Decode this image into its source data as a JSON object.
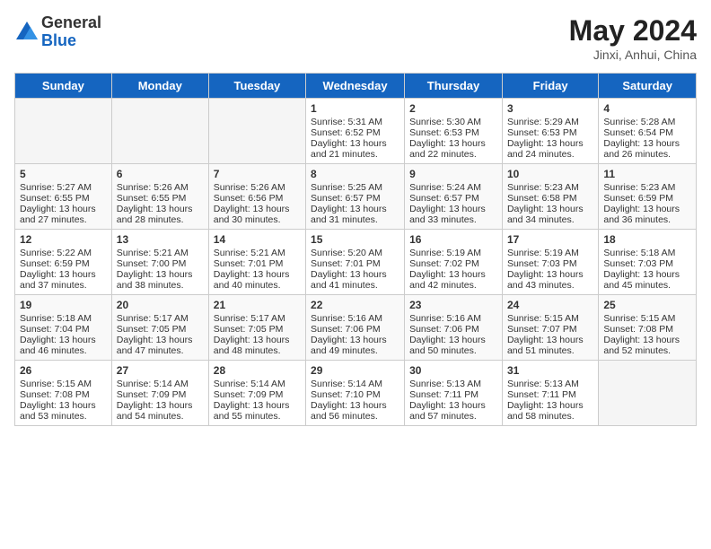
{
  "logo": {
    "general": "General",
    "blue": "Blue"
  },
  "title": {
    "month_year": "May 2024",
    "location": "Jinxi, Anhui, China"
  },
  "header_days": [
    "Sunday",
    "Monday",
    "Tuesday",
    "Wednesday",
    "Thursday",
    "Friday",
    "Saturday"
  ],
  "weeks": [
    [
      {
        "day": "",
        "sunrise": "",
        "sunset": "",
        "daylight": ""
      },
      {
        "day": "",
        "sunrise": "",
        "sunset": "",
        "daylight": ""
      },
      {
        "day": "",
        "sunrise": "",
        "sunset": "",
        "daylight": ""
      },
      {
        "day": "1",
        "sunrise": "Sunrise: 5:31 AM",
        "sunset": "Sunset: 6:52 PM",
        "daylight": "Daylight: 13 hours and 21 minutes."
      },
      {
        "day": "2",
        "sunrise": "Sunrise: 5:30 AM",
        "sunset": "Sunset: 6:53 PM",
        "daylight": "Daylight: 13 hours and 22 minutes."
      },
      {
        "day": "3",
        "sunrise": "Sunrise: 5:29 AM",
        "sunset": "Sunset: 6:53 PM",
        "daylight": "Daylight: 13 hours and 24 minutes."
      },
      {
        "day": "4",
        "sunrise": "Sunrise: 5:28 AM",
        "sunset": "Sunset: 6:54 PM",
        "daylight": "Daylight: 13 hours and 26 minutes."
      }
    ],
    [
      {
        "day": "5",
        "sunrise": "Sunrise: 5:27 AM",
        "sunset": "Sunset: 6:55 PM",
        "daylight": "Daylight: 13 hours and 27 minutes."
      },
      {
        "day": "6",
        "sunrise": "Sunrise: 5:26 AM",
        "sunset": "Sunset: 6:55 PM",
        "daylight": "Daylight: 13 hours and 28 minutes."
      },
      {
        "day": "7",
        "sunrise": "Sunrise: 5:26 AM",
        "sunset": "Sunset: 6:56 PM",
        "daylight": "Daylight: 13 hours and 30 minutes."
      },
      {
        "day": "8",
        "sunrise": "Sunrise: 5:25 AM",
        "sunset": "Sunset: 6:57 PM",
        "daylight": "Daylight: 13 hours and 31 minutes."
      },
      {
        "day": "9",
        "sunrise": "Sunrise: 5:24 AM",
        "sunset": "Sunset: 6:57 PM",
        "daylight": "Daylight: 13 hours and 33 minutes."
      },
      {
        "day": "10",
        "sunrise": "Sunrise: 5:23 AM",
        "sunset": "Sunset: 6:58 PM",
        "daylight": "Daylight: 13 hours and 34 minutes."
      },
      {
        "day": "11",
        "sunrise": "Sunrise: 5:23 AM",
        "sunset": "Sunset: 6:59 PM",
        "daylight": "Daylight: 13 hours and 36 minutes."
      }
    ],
    [
      {
        "day": "12",
        "sunrise": "Sunrise: 5:22 AM",
        "sunset": "Sunset: 6:59 PM",
        "daylight": "Daylight: 13 hours and 37 minutes."
      },
      {
        "day": "13",
        "sunrise": "Sunrise: 5:21 AM",
        "sunset": "Sunset: 7:00 PM",
        "daylight": "Daylight: 13 hours and 38 minutes."
      },
      {
        "day": "14",
        "sunrise": "Sunrise: 5:21 AM",
        "sunset": "Sunset: 7:01 PM",
        "daylight": "Daylight: 13 hours and 40 minutes."
      },
      {
        "day": "15",
        "sunrise": "Sunrise: 5:20 AM",
        "sunset": "Sunset: 7:01 PM",
        "daylight": "Daylight: 13 hours and 41 minutes."
      },
      {
        "day": "16",
        "sunrise": "Sunrise: 5:19 AM",
        "sunset": "Sunset: 7:02 PM",
        "daylight": "Daylight: 13 hours and 42 minutes."
      },
      {
        "day": "17",
        "sunrise": "Sunrise: 5:19 AM",
        "sunset": "Sunset: 7:03 PM",
        "daylight": "Daylight: 13 hours and 43 minutes."
      },
      {
        "day": "18",
        "sunrise": "Sunrise: 5:18 AM",
        "sunset": "Sunset: 7:03 PM",
        "daylight": "Daylight: 13 hours and 45 minutes."
      }
    ],
    [
      {
        "day": "19",
        "sunrise": "Sunrise: 5:18 AM",
        "sunset": "Sunset: 7:04 PM",
        "daylight": "Daylight: 13 hours and 46 minutes."
      },
      {
        "day": "20",
        "sunrise": "Sunrise: 5:17 AM",
        "sunset": "Sunset: 7:05 PM",
        "daylight": "Daylight: 13 hours and 47 minutes."
      },
      {
        "day": "21",
        "sunrise": "Sunrise: 5:17 AM",
        "sunset": "Sunset: 7:05 PM",
        "daylight": "Daylight: 13 hours and 48 minutes."
      },
      {
        "day": "22",
        "sunrise": "Sunrise: 5:16 AM",
        "sunset": "Sunset: 7:06 PM",
        "daylight": "Daylight: 13 hours and 49 minutes."
      },
      {
        "day": "23",
        "sunrise": "Sunrise: 5:16 AM",
        "sunset": "Sunset: 7:06 PM",
        "daylight": "Daylight: 13 hours and 50 minutes."
      },
      {
        "day": "24",
        "sunrise": "Sunrise: 5:15 AM",
        "sunset": "Sunset: 7:07 PM",
        "daylight": "Daylight: 13 hours and 51 minutes."
      },
      {
        "day": "25",
        "sunrise": "Sunrise: 5:15 AM",
        "sunset": "Sunset: 7:08 PM",
        "daylight": "Daylight: 13 hours and 52 minutes."
      }
    ],
    [
      {
        "day": "26",
        "sunrise": "Sunrise: 5:15 AM",
        "sunset": "Sunset: 7:08 PM",
        "daylight": "Daylight: 13 hours and 53 minutes."
      },
      {
        "day": "27",
        "sunrise": "Sunrise: 5:14 AM",
        "sunset": "Sunset: 7:09 PM",
        "daylight": "Daylight: 13 hours and 54 minutes."
      },
      {
        "day": "28",
        "sunrise": "Sunrise: 5:14 AM",
        "sunset": "Sunset: 7:09 PM",
        "daylight": "Daylight: 13 hours and 55 minutes."
      },
      {
        "day": "29",
        "sunrise": "Sunrise: 5:14 AM",
        "sunset": "Sunset: 7:10 PM",
        "daylight": "Daylight: 13 hours and 56 minutes."
      },
      {
        "day": "30",
        "sunrise": "Sunrise: 5:13 AM",
        "sunset": "Sunset: 7:11 PM",
        "daylight": "Daylight: 13 hours and 57 minutes."
      },
      {
        "day": "31",
        "sunrise": "Sunrise: 5:13 AM",
        "sunset": "Sunset: 7:11 PM",
        "daylight": "Daylight: 13 hours and 58 minutes."
      },
      {
        "day": "",
        "sunrise": "",
        "sunset": "",
        "daylight": ""
      }
    ]
  ]
}
